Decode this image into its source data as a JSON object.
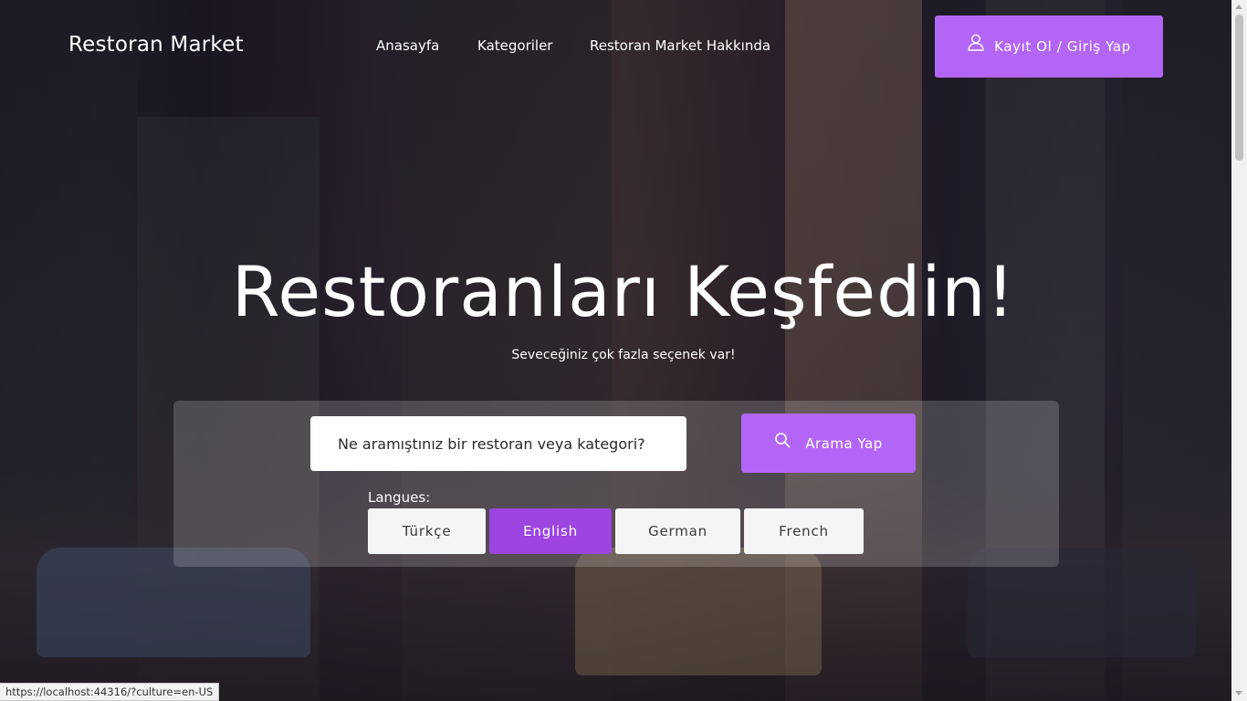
{
  "header": {
    "brand": "Restoran Market",
    "nav": [
      {
        "label": "Anasayfa"
      },
      {
        "label": "Kategoriler"
      },
      {
        "label": "Restoran Market Hakkında"
      }
    ],
    "login_label": "Kayıt Ol / Giriş Yap",
    "login_icon": "user-icon"
  },
  "hero": {
    "title": "Restoranları Keşfedin!",
    "subtitle": "Seveceğiniz çok fazla seçenek var!"
  },
  "search": {
    "placeholder": "Ne aramıştınız bir restoran veya kategori?",
    "value": "",
    "button_label": "Arama Yap",
    "button_icon": "search-icon"
  },
  "languages": {
    "label": "Langues:",
    "options": [
      {
        "label": "Türkçe",
        "active": false
      },
      {
        "label": "English",
        "active": true
      },
      {
        "label": "German",
        "active": false
      },
      {
        "label": "French",
        "active": false
      }
    ]
  },
  "status_bar": {
    "url": "https://localhost:44316/?culture=en-US"
  },
  "colors": {
    "accent": "#b366f5",
    "accent_active": "#9c45e0",
    "text_light": "#ffffff"
  }
}
